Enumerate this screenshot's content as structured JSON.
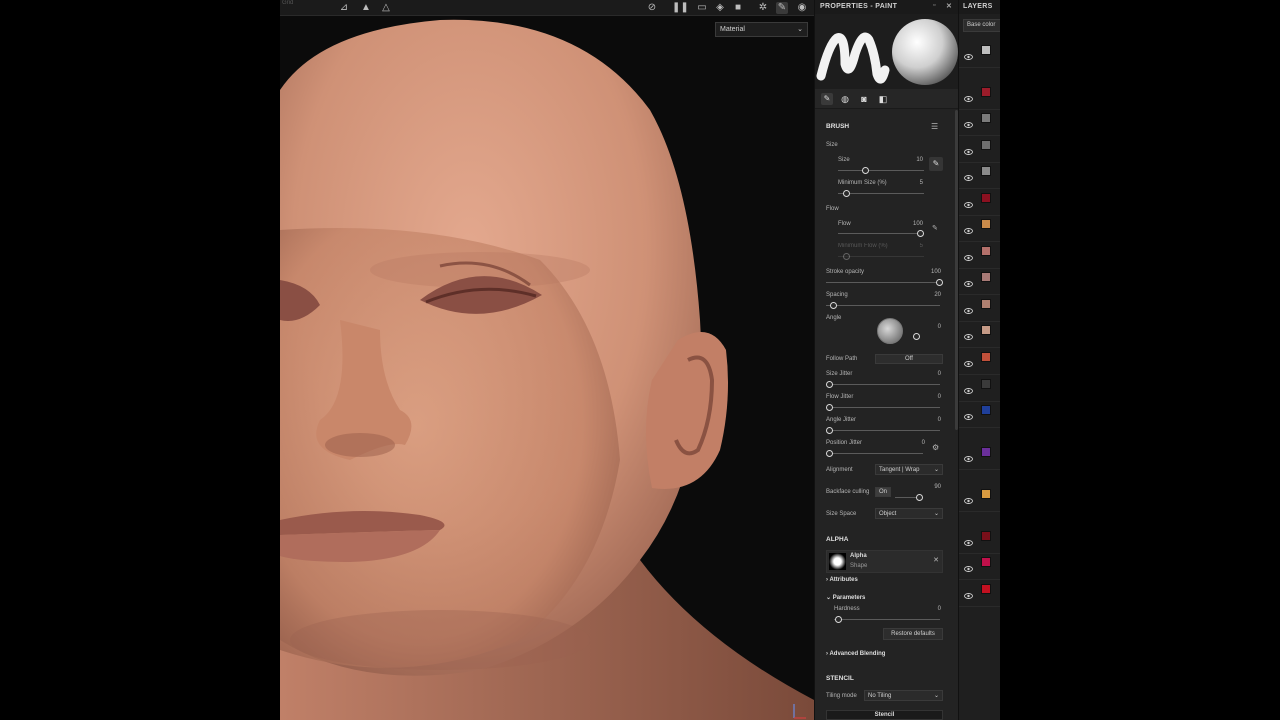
{
  "viewport": {
    "material_select": "Material",
    "toolbar_faded": "Grid"
  },
  "properties": {
    "title": "PROPERTIES - PAINT",
    "brush": {
      "section": "BRUSH",
      "size_group": "Size",
      "size_label": "Size",
      "size_value": "10",
      "min_size_label": "Minimum Size (%)",
      "min_size_value": "5",
      "flow_group": "Flow",
      "flow_label": "Flow",
      "flow_value": "100",
      "min_flow_label": "Minimum Flow (%)",
      "min_flow_value": "5",
      "stroke_opacity_label": "Stroke opacity",
      "stroke_opacity_value": "100",
      "spacing_label": "Spacing",
      "spacing_value": "20",
      "angle_label": "Angle",
      "angle_value": "0",
      "follow_path_label": "Follow Path",
      "follow_path_value": "Off",
      "size_jitter_label": "Size Jitter",
      "size_jitter_value": "0",
      "flow_jitter_label": "Flow Jitter",
      "flow_jitter_value": "0",
      "angle_jitter_label": "Angle Jitter",
      "angle_jitter_value": "0",
      "position_jitter_label": "Position Jitter",
      "position_jitter_value": "0",
      "alignment_label": "Alignment",
      "alignment_value": "Tangent | Wrap",
      "backface_label": "Backface culling",
      "backface_toggle": "On",
      "backface_value": "90",
      "size_space_label": "Size Space",
      "size_space_value": "Object"
    },
    "alpha": {
      "section": "ALPHA",
      "name": "Alpha",
      "sub": "Shape",
      "attributes": "Attributes",
      "parameters": "Parameters",
      "hardness_label": "Hardness",
      "hardness_value": "0",
      "restore": "Restore defaults",
      "advanced": "Advanced Blending"
    },
    "stencil": {
      "section": "STENCIL",
      "tiling_label": "Tiling mode",
      "tiling_value": "No Tiling",
      "button": "Stencil"
    }
  },
  "layers": {
    "title": "LAYERS",
    "channel": "Base color",
    "thumb_colors": [
      "#bdbdbd",
      "#9b1c2a",
      "#7a7a7a",
      "#6e6e6e",
      "#8a8a8a",
      "#8b1020",
      "#c98a4a",
      "#b3706a",
      "#a87a76",
      "#b08070",
      "#c59a86",
      "#c0503a",
      "#3a3a3a",
      "#1f3f9a",
      "#6a2f9a",
      "#d89a40",
      "#7a0f1a",
      "#c0104a",
      "#c21020"
    ]
  }
}
